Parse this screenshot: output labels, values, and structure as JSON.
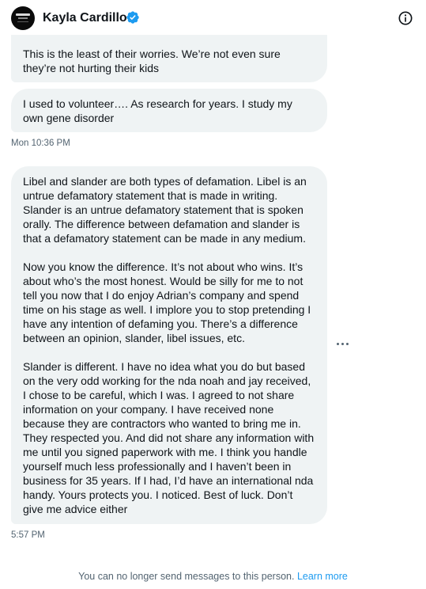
{
  "header": {
    "name": "Kayla Cardillo",
    "verified_icon": "verified-badge-icon",
    "info_icon": "info-icon"
  },
  "messages": [
    {
      "text": "This is the least of their worries. We’re not even sure they’re not hurting their kids"
    },
    {
      "text": "I used to volunteer…. As research for years. I study my own gene disorder"
    },
    {
      "text": "Libel and slander are both types of defamation. Libel is an untrue defamatory statement that is made in writing. Slander is an untrue defamatory statement that is spoken orally. The difference between defamation and slander is that a defamatory statement can be made in any medium.\n\nNow you know the difference. It’s not about who wins. It’s about who’s the most honest. Would be silly for me to not tell you now that I do enjoy Adrian’s company and spend time on his stage as well. I implore you to stop pretending I have any intention of defaming you. There’s a difference between an opinion, slander, libel issues, etc.\n\nSlander is different. I have no idea what you do but based on the very odd working for the nda noah and jay received, I chose to be careful, which I was. I agreed to not share information on your company. I have received none because they are contractors who wanted to bring me in. They respected you. And did not share any information with me until you signed paperwork with me. I think you handle yourself much less professionally and I haven’t been in business for 35 years. If I had, I’d have an international nda handy. Yours protects you. I noticed. Best of luck. Don’t give me advice either"
    }
  ],
  "timestamps": {
    "first": "Mon 10:36 PM",
    "second": "5:57 PM"
  },
  "more_icon": "more-horizontal-icon",
  "footer": {
    "notice": "You can no longer send messages to this person.",
    "link": "Learn more"
  },
  "colors": {
    "bubble": "#eff3f4",
    "accent": "#1d9bf0",
    "muted": "#536471",
    "text": "#0f1419"
  }
}
